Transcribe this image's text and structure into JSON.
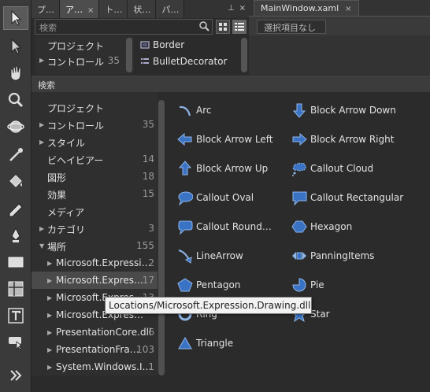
{
  "asset_tabs": [
    {
      "label": "プ…"
    },
    {
      "label": "ア…",
      "close": "×"
    },
    {
      "label": "ト…"
    },
    {
      "label": "状…"
    },
    {
      "label": "パ…"
    }
  ],
  "pin_glyph": "⊥",
  "close_glyph": "×",
  "document": {
    "tab_label": "MainWindow.xaml",
    "close": "×",
    "selection": "選択項目なし"
  },
  "top_panel": {
    "search_placeholder": "検索",
    "categories": [
      {
        "label": "プロジェクト",
        "count": ""
      },
      {
        "label": "コントロール",
        "count": "35",
        "arrow": "▶"
      }
    ],
    "items": [
      {
        "label": "Border"
      },
      {
        "label": "BulletDecorator"
      }
    ]
  },
  "panel": {
    "header": "検索",
    "categories": [
      {
        "label": "プロジェクト",
        "count": ""
      },
      {
        "label": "コントロール",
        "count": "35",
        "arrow": "▶"
      },
      {
        "label": "スタイル",
        "count": "",
        "arrow": "▶"
      },
      {
        "label": "ビヘイビアー",
        "count": "14"
      },
      {
        "label": "図形",
        "count": "18"
      },
      {
        "label": "効果",
        "count": "15"
      },
      {
        "label": "メディア",
        "count": ""
      },
      {
        "label": "カテゴリ",
        "count": "3",
        "arrow": "▶"
      },
      {
        "label": "場所",
        "count": "155",
        "arrow": "▼"
      },
      {
        "label": "Microsoft.Expressi…",
        "count": "2",
        "arrow": "▶",
        "sub": true
      },
      {
        "label": "Microsoft.Expres…",
        "count": "17",
        "arrow": "▶",
        "sub": true
      },
      {
        "label": "Microsoft.Expres…",
        "count": "13",
        "arrow": "▶",
        "sub": true
      },
      {
        "label": "Microsoft.Expres…",
        "count": "",
        "arrow": "▶",
        "sub": true
      },
      {
        "label": "PresentationCore.dll",
        "count": "6",
        "arrow": "▶",
        "sub": true
      },
      {
        "label": "PresentationFra…",
        "count": "103",
        "arrow": "▶",
        "sub": true
      },
      {
        "label": "System.Windows.I…",
        "count": "1",
        "arrow": "▶",
        "sub": true
      }
    ],
    "shapes": [
      {
        "label": "Arc",
        "icon": "arc-icon"
      },
      {
        "label": "Block Arrow Down",
        "icon": "block-arrow-down-icon"
      },
      {
        "label": "Block Arrow Left",
        "icon": "block-arrow-left-icon"
      },
      {
        "label": "Block Arrow Right",
        "icon": "block-arrow-right-icon"
      },
      {
        "label": "Block Arrow Up",
        "icon": "block-arrow-up-icon"
      },
      {
        "label": "Callout Cloud",
        "icon": "callout-cloud-icon"
      },
      {
        "label": "Callout Oval",
        "icon": "callout-oval-icon"
      },
      {
        "label": "Callout Rectangular",
        "icon": "callout-rectangular-icon"
      },
      {
        "label": "Callout  Round…",
        "icon": "callout-rounded-icon"
      },
      {
        "label": "Hexagon",
        "icon": "hexagon-icon"
      },
      {
        "label": "LineArrow",
        "icon": "line-arrow-icon"
      },
      {
        "label": "PanningItems",
        "icon": "panning-items-icon"
      },
      {
        "label": "Pentagon",
        "icon": "pentagon-icon"
      },
      {
        "label": "Pie",
        "icon": "pie-icon"
      },
      {
        "label": "Ring",
        "icon": "ring-icon"
      },
      {
        "label": "Star",
        "icon": "star-icon"
      },
      {
        "label": "Triangle",
        "icon": "triangle-icon"
      }
    ],
    "tooltip": "Locations/Microsoft.Expression.Drawing.dll"
  },
  "colors": {
    "shape_fill": "#3a73c4",
    "shape_stroke": "#8fb6ea",
    "background": "#2b2b2b"
  }
}
